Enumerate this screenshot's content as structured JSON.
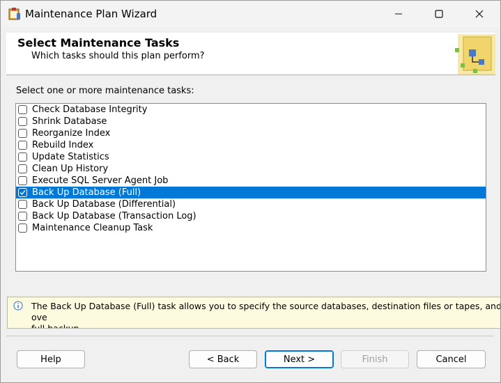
{
  "window": {
    "title": "Maintenance Plan Wizard",
    "icons": {
      "app": "wizard-app-icon",
      "minimize": "minimize-icon",
      "maximize": "maximize-icon",
      "close": "close-icon"
    }
  },
  "header": {
    "title": "Select Maintenance Tasks",
    "subtitle": "Which tasks should this plan perform?",
    "image_icon": "wizard-banner-icon"
  },
  "task_list": {
    "label": "Select one or more maintenance tasks:",
    "items": [
      {
        "label": "Check Database Integrity",
        "checked": false,
        "selected": false
      },
      {
        "label": "Shrink Database",
        "checked": false,
        "selected": false
      },
      {
        "label": "Reorganize Index",
        "checked": false,
        "selected": false
      },
      {
        "label": "Rebuild Index",
        "checked": false,
        "selected": false
      },
      {
        "label": "Update Statistics",
        "checked": false,
        "selected": false
      },
      {
        "label": "Clean Up History",
        "checked": false,
        "selected": false
      },
      {
        "label": "Execute SQL Server Agent Job",
        "checked": false,
        "selected": false
      },
      {
        "label": "Back Up Database (Full)",
        "checked": true,
        "selected": true
      },
      {
        "label": "Back Up Database (Differential)",
        "checked": false,
        "selected": false
      },
      {
        "label": "Back Up Database (Transaction Log)",
        "checked": false,
        "selected": false
      },
      {
        "label": "Maintenance Cleanup Task",
        "checked": false,
        "selected": false
      }
    ]
  },
  "info": {
    "icon": "info-icon",
    "text": "The Back Up Database (Full) task allows you to specify the source databases, destination files or tapes, and ove\nfull backup."
  },
  "buttons": {
    "help": "Help",
    "back": "< Back",
    "next": "Next >",
    "finish": "Finish",
    "cancel": "Cancel"
  },
  "colors": {
    "selection": "#0078d7",
    "info_background": "#fcfbe0",
    "window_background": "#f0f0f0"
  }
}
